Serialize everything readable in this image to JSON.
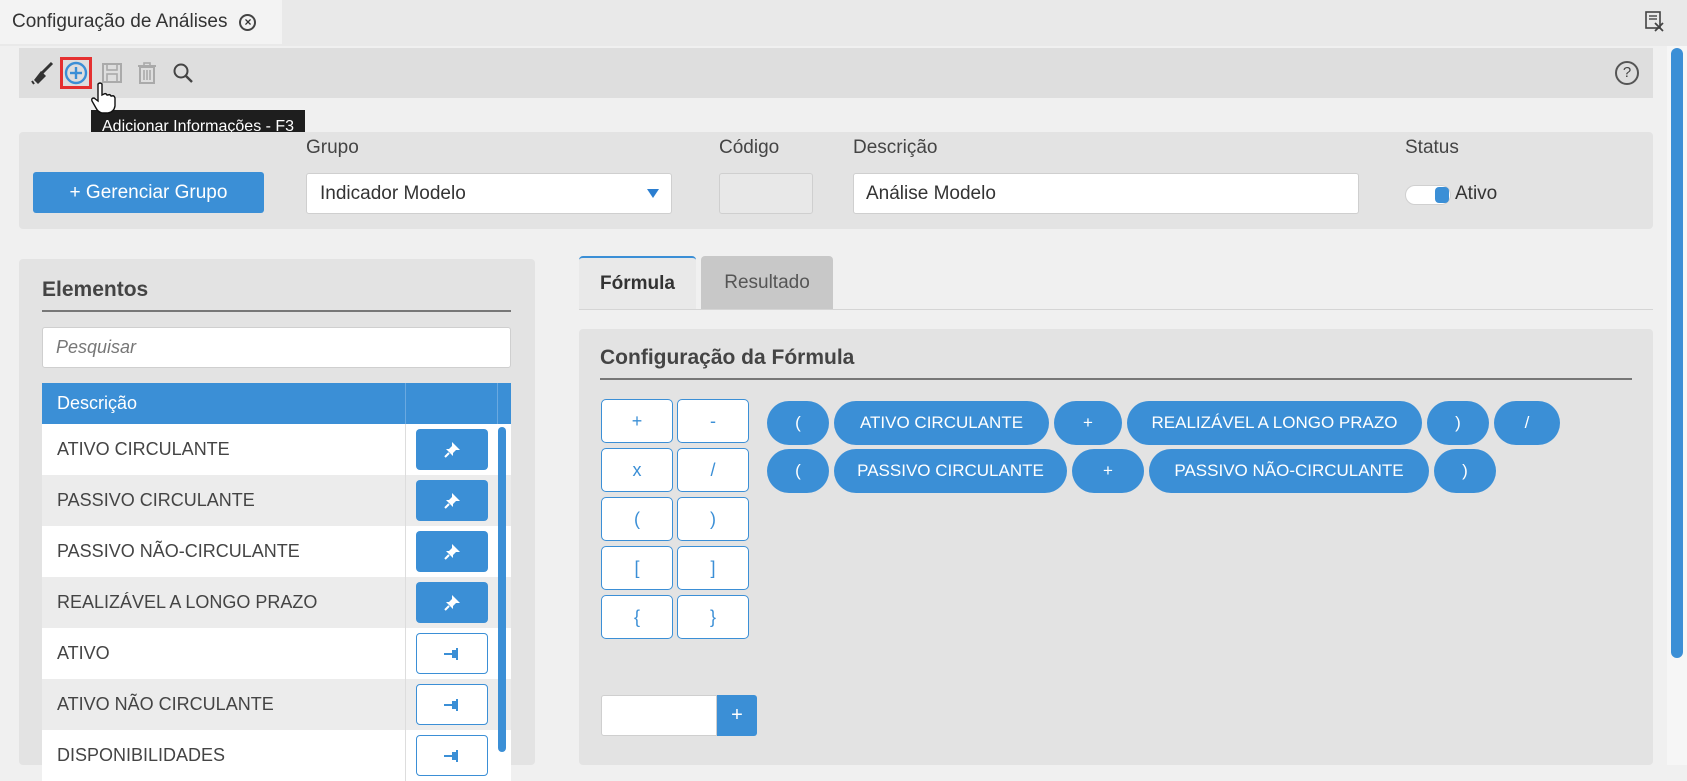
{
  "window": {
    "tab_title": "Configuração de Análises",
    "tab_close_symbol": "⊗"
  },
  "toolbar": {
    "icons": [
      "broom-icon",
      "add-circle-icon",
      "save-icon",
      "trash-icon",
      "search-icon"
    ],
    "help_symbol": "?",
    "tooltip": "Adicionar Informações - F3"
  },
  "header_form": {
    "manage_group_button": "+ Gerenciar Grupo",
    "grupo_label": "Grupo",
    "grupo_value": "Indicador Modelo",
    "codigo_label": "Código",
    "codigo_value": "",
    "descricao_label": "Descrição",
    "descricao_value": "Análise Modelo",
    "status_label": "Status",
    "status_value": "Ativo"
  },
  "elements_panel": {
    "title": "Elementos",
    "search_placeholder": "Pesquisar",
    "column_header": "Descrição",
    "rows": [
      {
        "label": "ATIVO CIRCULANTE",
        "pinned": true
      },
      {
        "label": "PASSIVO CIRCULANTE",
        "pinned": true
      },
      {
        "label": "PASSIVO NÃO-CIRCULANTE",
        "pinned": true
      },
      {
        "label": "REALIZÁVEL A LONGO PRAZO",
        "pinned": true
      },
      {
        "label": "ATIVO",
        "pinned": false
      },
      {
        "label": "ATIVO NÃO CIRCULANTE",
        "pinned": false
      },
      {
        "label": "DISPONIBILIDADES",
        "pinned": false
      }
    ]
  },
  "tabs": [
    {
      "label": "Fórmula",
      "active": true
    },
    {
      "label": "Resultado",
      "active": false
    }
  ],
  "formula_panel": {
    "title": "Configuração da Fórmula",
    "operators": [
      "+",
      "-",
      "x",
      "/",
      "(",
      ")",
      "[",
      "]",
      "{",
      "}"
    ],
    "formula_line_1": [
      "(",
      "ATIVO CIRCULANTE",
      "+",
      "REALIZÁVEL A LONGO PRAZO",
      ")",
      "/"
    ],
    "formula_line_2": [
      "(",
      "PASSIVO CIRCULANTE",
      "+",
      "PASSIVO NÃO-CIRCULANTE",
      ")"
    ],
    "number_add_label": "+"
  },
  "colors": {
    "accent": "#3b8fd6",
    "highlight_border": "#e53030"
  }
}
